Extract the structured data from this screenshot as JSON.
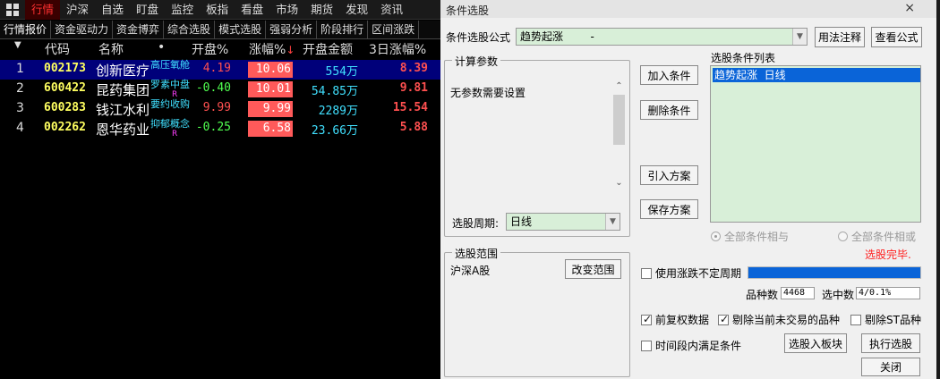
{
  "app": {
    "topnav": [
      "行情",
      "沪深",
      "自选",
      "盯盘",
      "监控",
      "板指",
      "看盘",
      "市场",
      "期货",
      "发现",
      "资讯"
    ],
    "subnav": [
      "行情报价",
      "资金驱动力",
      "资金博弈",
      "综合选股",
      "模式选股",
      "强弱分析",
      "阶段排行",
      "区间涨跌"
    ],
    "columns": {
      "code": "代码",
      "name": "名称",
      "dot": "•",
      "open": "开盘%",
      "change": "涨幅%",
      "change_arrow": "↓",
      "amount": "开盘金额",
      "three_day": "3日涨幅%"
    },
    "rows": [
      {
        "idx": "1",
        "code": "002173",
        "name": "创新医疗",
        "tag": "高压氧舱",
        "badge": "",
        "open": "4.19",
        "change": "10.06",
        "amount": "554万",
        "three_day": "8.39",
        "open_dir": "pos"
      },
      {
        "idx": "2",
        "code": "600422",
        "name": "昆药集团",
        "tag": "罗素中盘",
        "badge": "R",
        "open": "-0.40",
        "change": "10.01",
        "amount": "54.85万",
        "three_day": "9.81",
        "open_dir": "neg"
      },
      {
        "idx": "3",
        "code": "600283",
        "name": "钱江水利",
        "tag": "要约收购",
        "badge": "",
        "open": "9.99",
        "change": "9.99",
        "amount": "2289万",
        "three_day": "15.54",
        "open_dir": "pos"
      },
      {
        "idx": "4",
        "code": "002262",
        "name": "恩华药业",
        "tag": "抑郁概念",
        "badge": "R",
        "open": "-0.25",
        "change": "6.58",
        "amount": "23.66万",
        "three_day": "5.88",
        "open_dir": "neg"
      }
    ]
  },
  "dialog": {
    "title": "条件选股",
    "close_glyph": "×",
    "formula_label": "条件选股公式",
    "formula_value": "趋势起涨        -",
    "usage_btn": "用法注释",
    "view_formula_btn": "查看公式",
    "params_legend": "计算参数",
    "params_text": "无参数需要设置",
    "period_label": "选股周期:",
    "period_value": "日线",
    "add_btn": "加入条件",
    "delete_btn": "删除条件",
    "import_btn": "引入方案",
    "save_btn": "保存方案",
    "conditions_label": "选股条件列表",
    "conditions": [
      "趋势起涨  日线"
    ],
    "radio_and": "全部条件相与",
    "radio_or": "全部条件相或",
    "range_legend": "选股范围",
    "range_value": "沪深A股",
    "change_range_btn": "改变范围",
    "status": "选股完毕.",
    "use_period_label": "使用涨跌不定周期",
    "count_label": "品种数",
    "count_value": "4468",
    "hit_label": "选中数",
    "hit_value": "4/0.1%",
    "pre_adjust_label": "前复权数据",
    "exclude_untraded_label": "剔除当前未交易的品种",
    "exclude_st_label": "剔除ST品种",
    "time_range_label": "时间段内满足条件",
    "to_block_btn": "选股入板块",
    "run_btn": "执行选股",
    "close_btn": "关闭",
    "progress": 1.0
  }
}
